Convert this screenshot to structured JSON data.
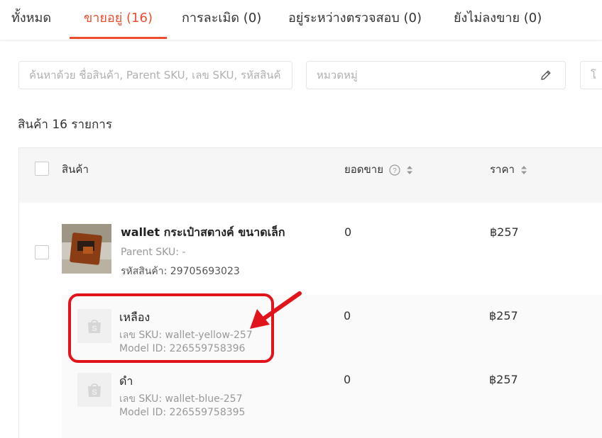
{
  "tabs": [
    {
      "label": "ทั้งหมด",
      "active": false
    },
    {
      "label": "ขายอยู่ (16)",
      "active": true
    },
    {
      "label": "การละเมิด (0)",
      "active": false
    },
    {
      "label": "อยู่ระหว่างตรวจสอบ (0)",
      "active": false
    },
    {
      "label": "ยังไม่ลงขาย (0)",
      "active": false
    }
  ],
  "filters": {
    "search_placeholder": "ค้นหาด้วย ชื่อสินค้า, Parent SKU, เลข SKU, รหัสสินค้า",
    "category_placeholder": "หมวดหมู่",
    "third_placeholder": "โ",
    "edit_icon": "pencil-icon"
  },
  "summary": {
    "count_text": "สินค้า 16 รายการ"
  },
  "table": {
    "headers": {
      "product": "สินค้า",
      "sales": "ยอดขาย",
      "price": "ราคา"
    },
    "product": {
      "name": "wallet กระเป๋าสตางค์ ขนาดเล็ก",
      "parent_sku": "Parent SKU: -",
      "product_id": "รหัสสินค้า: 29705693023",
      "sales": "0",
      "price": "฿257",
      "variants": [
        {
          "name": "เหลือง",
          "sku": "เลข SKU: wallet-yellow-257",
          "model_id": "Model ID: 226559758396",
          "sales": "0",
          "price": "฿257",
          "highlighted": true
        },
        {
          "name": "ดำ",
          "sku": "เลข SKU: wallet-blue-257",
          "model_id": "Model ID: 226559758395",
          "sales": "0",
          "price": "฿257",
          "highlighted": false
        }
      ]
    }
  },
  "colors": {
    "accent": "#ee4d2d",
    "annotation": "#e1141c"
  }
}
